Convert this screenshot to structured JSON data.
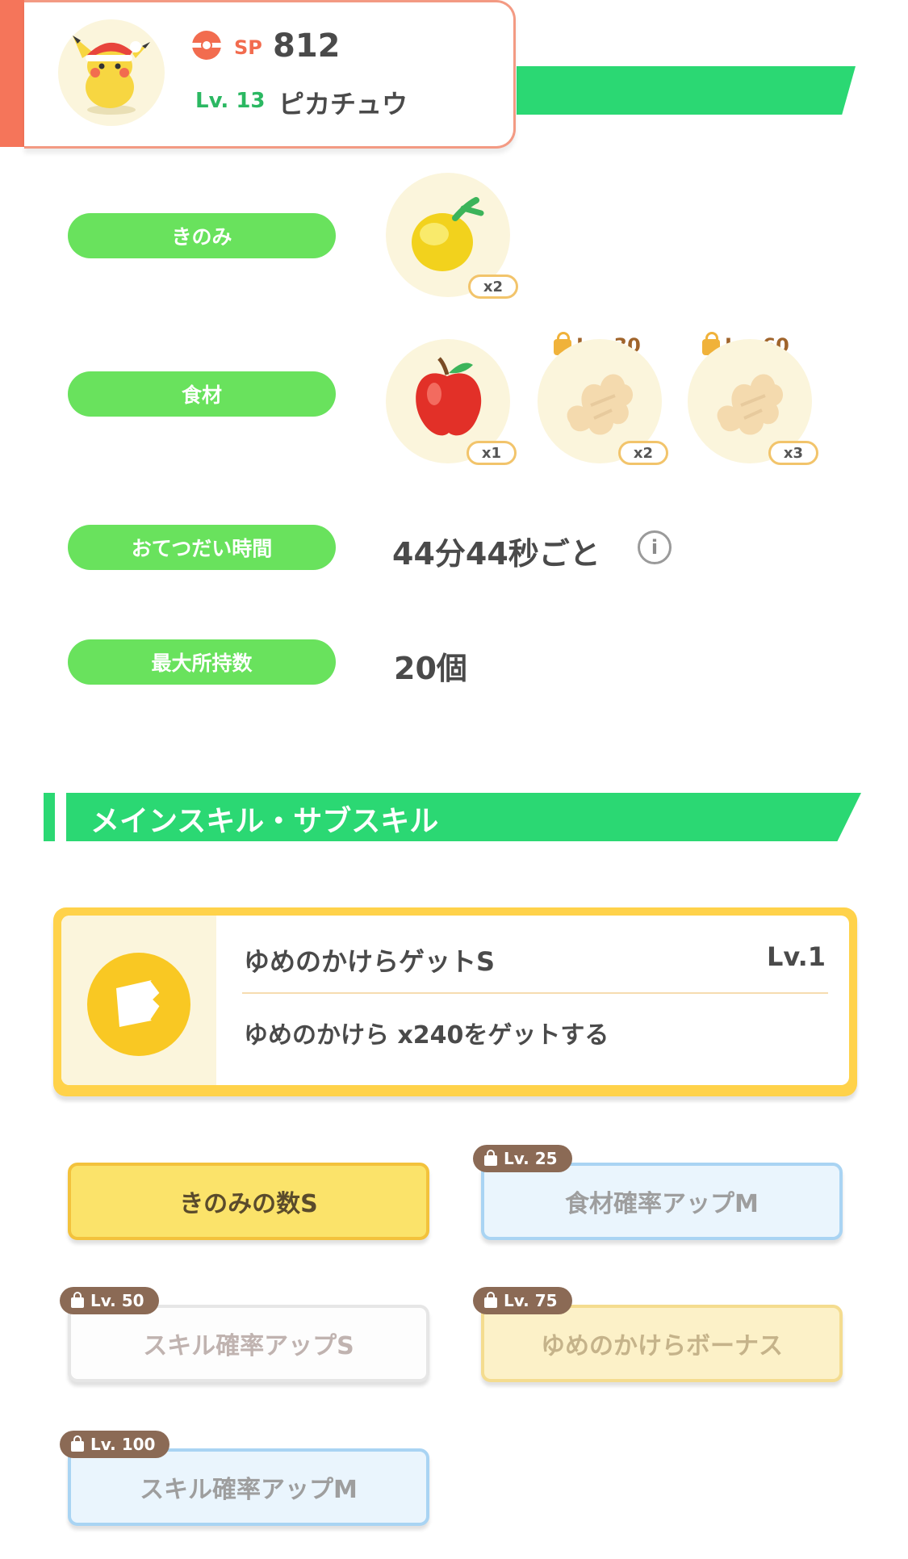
{
  "header": {
    "sp_label": "SP",
    "sp_value": "812",
    "level": "Lv. 13",
    "name": "ピカチュウ"
  },
  "info": {
    "berry": {
      "label": "きのみ",
      "count": "x2"
    },
    "ingredients": {
      "label": "食材",
      "items": [
        {
          "count": "x1",
          "unlock": ""
        },
        {
          "count": "x2",
          "unlock": "Lv. 30"
        },
        {
          "count": "x3",
          "unlock": "Lv. 60"
        }
      ]
    },
    "help_time": {
      "label": "おてつだい時間",
      "value": "44分44秒ごと",
      "info_icon": "i"
    },
    "max_carry": {
      "label": "最大所持数",
      "value": "20個"
    }
  },
  "section": {
    "title": "メインスキル・サブスキル"
  },
  "main_skill": {
    "name": "ゆめのかけらゲットS",
    "level": "Lv.1",
    "description": "ゆめのかけら x240をゲットする"
  },
  "sub_skills": [
    {
      "label": "きのみの数S",
      "unlock": ""
    },
    {
      "label": "食材確率アップM",
      "unlock": "Lv. 25"
    },
    {
      "label": "スキル確率アップS",
      "unlock": "Lv. 50"
    },
    {
      "label": "ゆめのかけらボーナス",
      "unlock": "Lv. 75"
    },
    {
      "label": "スキル確率アップM",
      "unlock": "Lv. 100"
    }
  ],
  "colors": {
    "accent_green": "#2bd873",
    "pill_green": "#69e25d",
    "header_orange": "#f5755a",
    "gold": "#fbe36a"
  }
}
